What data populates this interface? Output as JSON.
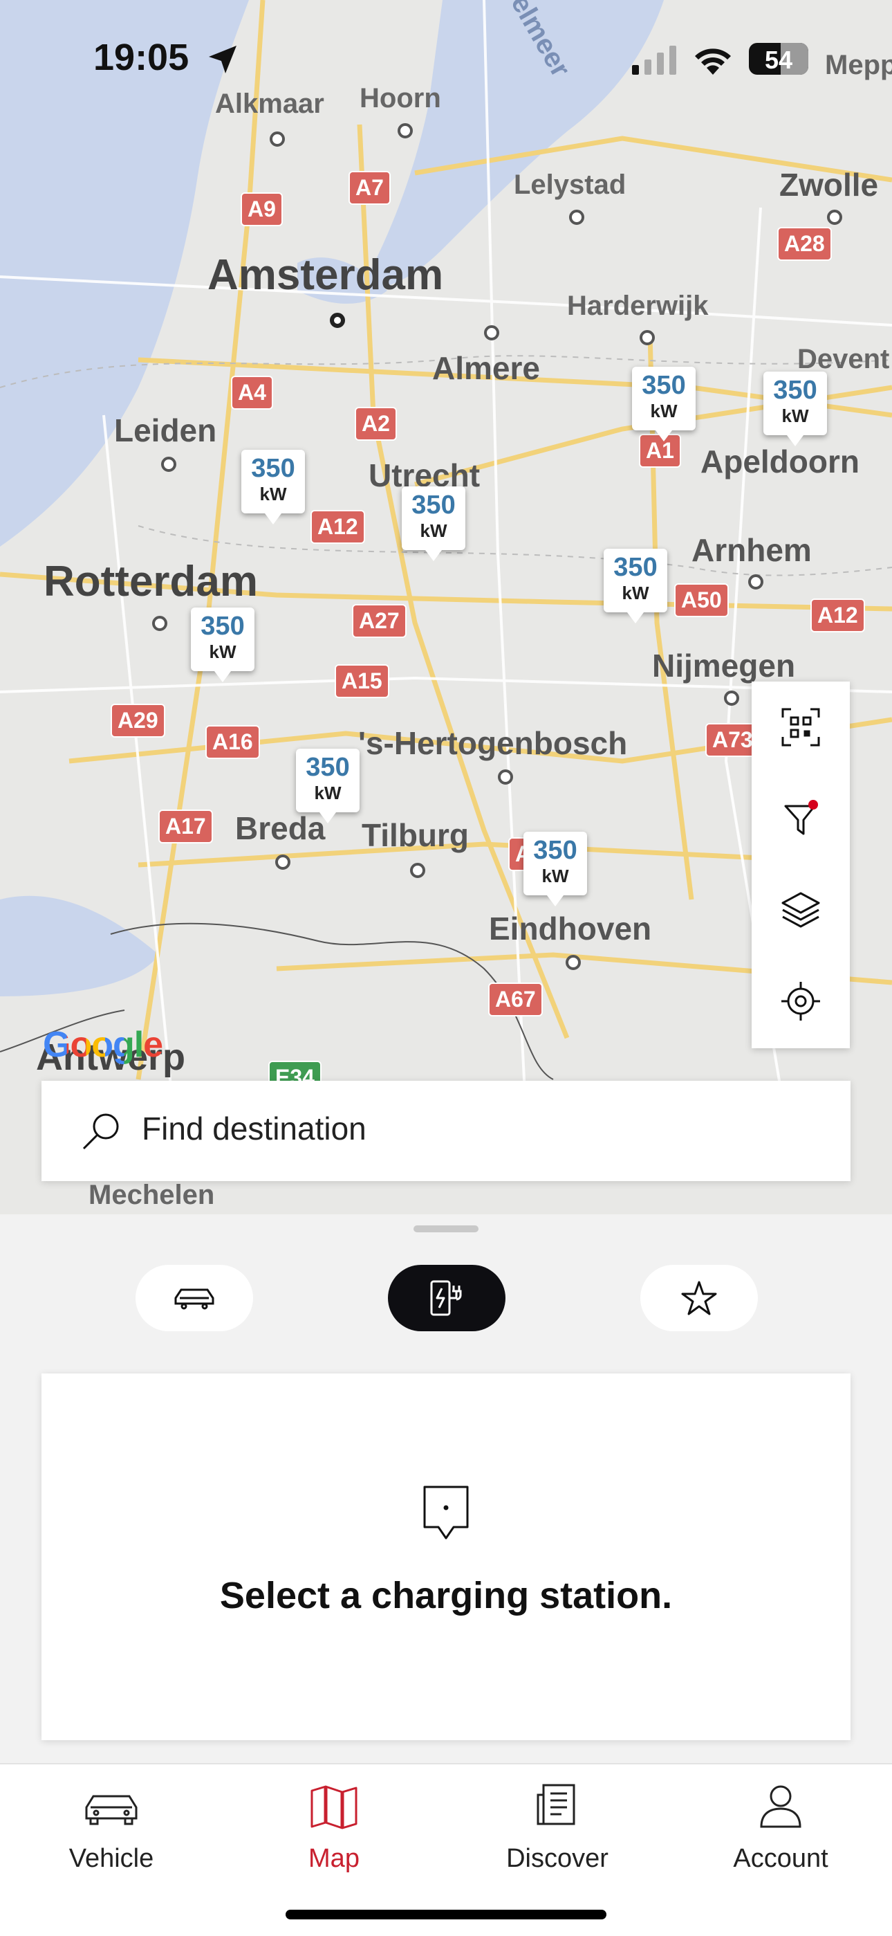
{
  "status_bar": {
    "time": "19:05",
    "battery": "54"
  },
  "map": {
    "places": {
      "amsterdam": "Amsterdam",
      "rotterdam": "Rotterdam",
      "utrecht": "Utrecht",
      "alkmaar": "Alkmaar",
      "hoorn": "Hoorn",
      "lelystad": "Lelystad",
      "zwolle": "Zwolle",
      "almere": "Almere",
      "harderwijk": "Harderwijk",
      "leiden": "Leiden",
      "apeldoorn": "Apeldoorn",
      "deventer": "Devent",
      "arnhem": "Arnhem",
      "nijmegen": "Nijmegen",
      "den_bosch": "'s-Hertogenbosch",
      "breda": "Breda",
      "tilburg": "Tilburg",
      "eindhoven": "Eindhoven",
      "antwerp": "Antwerp",
      "mechelen": "Mechelen",
      "meppel": "Mepp",
      "ijsselmeer": "selmeer"
    },
    "roads": [
      "A7",
      "A9",
      "A28",
      "A4",
      "A2",
      "A1",
      "A12",
      "A27",
      "A50",
      "A12",
      "A15",
      "A29",
      "A16",
      "A73",
      "A17",
      "A",
      "A67",
      "E34"
    ],
    "charger_markers": [
      {
        "power": "350",
        "unit": "kW"
      },
      {
        "power": "350",
        "unit": "kW"
      },
      {
        "power": "350",
        "unit": "kW"
      },
      {
        "power": "350",
        "unit": "kW"
      },
      {
        "power": "350",
        "unit": "kW"
      },
      {
        "power": "350",
        "unit": "kW"
      },
      {
        "power": "350",
        "unit": "kW"
      },
      {
        "power": "350",
        "unit": "kW"
      }
    ],
    "attribution": "Google",
    "search_placeholder": "Find destination"
  },
  "sheet": {
    "empty_message": "Select a charging station."
  },
  "tabbar": {
    "vehicle": "Vehicle",
    "map": "Map",
    "discover": "Discover",
    "account": "Account"
  },
  "colors": {
    "accent": "#c8202f",
    "marker_text": "#3a78a8",
    "active_pill": "#0e0e12"
  }
}
